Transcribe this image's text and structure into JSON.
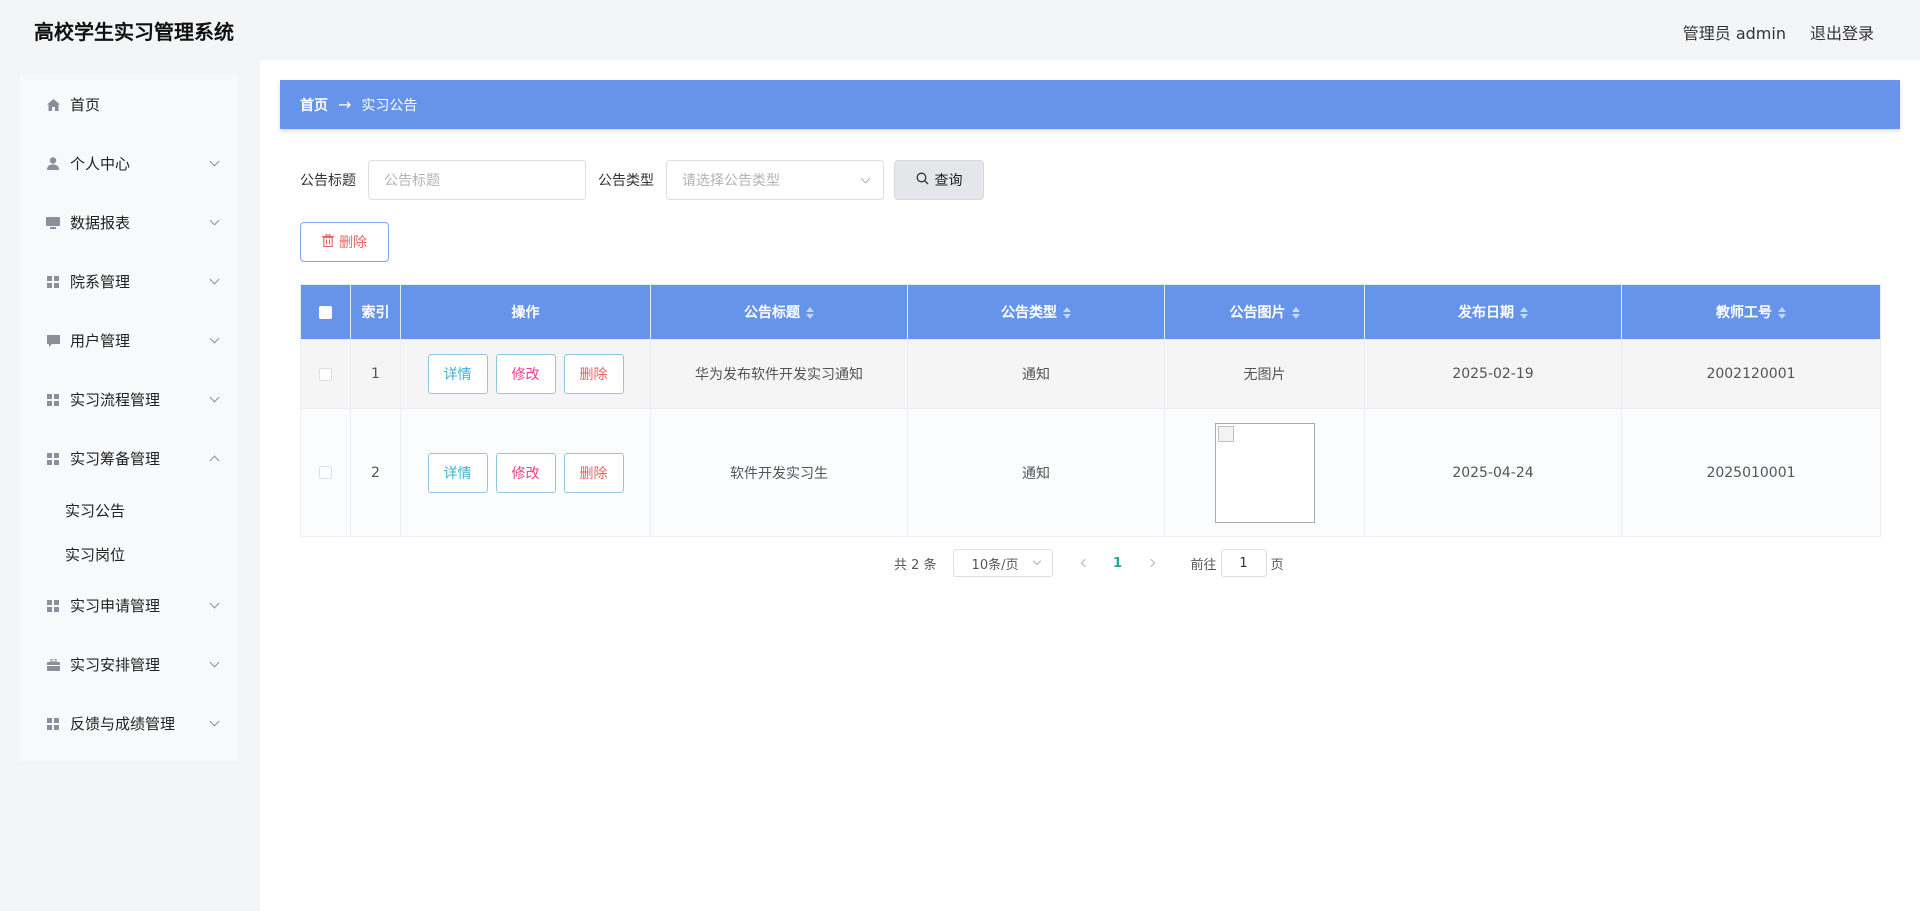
{
  "header": {
    "app_title": "高校学生实习管理系统",
    "user_label": "管理员 admin",
    "logout_label": "退出登录"
  },
  "sidebar": {
    "items": [
      {
        "label": "首页",
        "icon": "home-icon"
      },
      {
        "label": "个人中心",
        "icon": "user-icon"
      },
      {
        "label": "数据报表",
        "icon": "monitor-icon"
      },
      {
        "label": "院系管理",
        "icon": "grid-icon"
      },
      {
        "label": "用户管理",
        "icon": "chat-icon"
      },
      {
        "label": "实习流程管理",
        "icon": "grid-icon"
      },
      {
        "label": "实习筹备管理",
        "icon": "grid-icon",
        "open": true
      },
      {
        "label": "实习申请管理",
        "icon": "grid-icon"
      },
      {
        "label": "实习安排管理",
        "icon": "briefcase-icon"
      },
      {
        "label": "反馈与成绩管理",
        "icon": "grid-icon"
      }
    ],
    "sub_items": [
      "实习公告",
      "实习岗位"
    ]
  },
  "breadcrumb": {
    "home": "首页",
    "separator": "→",
    "current": "实习公告"
  },
  "search": {
    "title_label": "公告标题",
    "title_placeholder": "公告标题",
    "type_label": "公告类型",
    "type_placeholder": "请选择公告类型",
    "query_label": "查询"
  },
  "batch_delete_label": "删除",
  "table": {
    "headers": {
      "index": "索引",
      "ops": "操作",
      "title": "公告标题",
      "type": "公告类型",
      "image": "公告图片",
      "date": "发布日期",
      "teacher_id": "教师工号"
    },
    "op_labels": {
      "detail": "详情",
      "edit": "修改",
      "delete": "删除"
    },
    "rows": [
      {
        "index": "1",
        "title": "华为发布软件开发实习通知",
        "type": "通知",
        "image": "无图片",
        "date": "2025-02-19",
        "teacher_id": "2002120001"
      },
      {
        "index": "2",
        "title": "软件开发实习生",
        "type": "通知",
        "image": "",
        "date": "2025-04-24",
        "teacher_id": "2025010001"
      }
    ]
  },
  "pagination": {
    "total": "共 2 条",
    "page_size": "10条/页",
    "current_page": "1",
    "goto_label": "前往",
    "goto_value": "1",
    "page_unit": "页"
  },
  "colors": {
    "accent": "#6694ea",
    "danger": "#e8645f",
    "active_page": "#26a69a"
  }
}
